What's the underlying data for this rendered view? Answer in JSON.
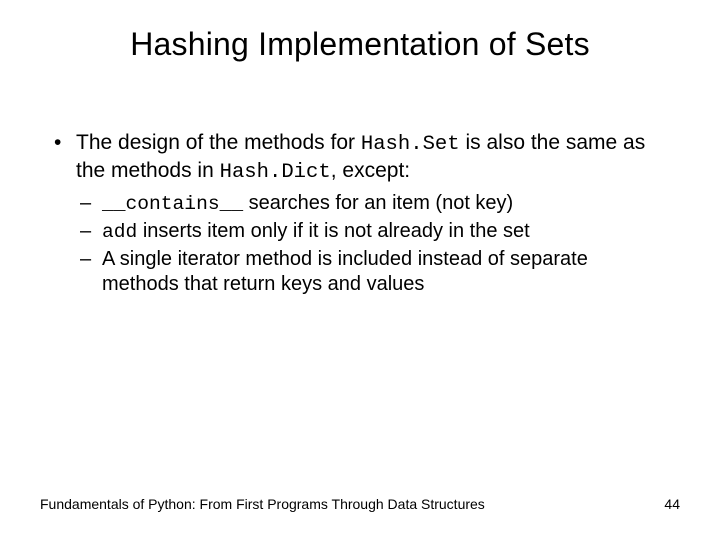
{
  "title": "Hashing Implementation of Sets",
  "bullet1": {
    "pre": "The design of the methods for ",
    "code": "Hash.Set",
    "mid": " is also the same as the methods in ",
    "code2": "Hash.Dict",
    "post": ", except:"
  },
  "sub1": {
    "code": "__contains__",
    "text": " searches for an item (not key)"
  },
  "sub2": {
    "code": "add",
    "text": " inserts item only if it is not already in the set"
  },
  "sub3": "A single iterator method is included instead of separate methods that return keys and values",
  "footer": {
    "source": "Fundamentals of Python: From First Programs Through Data Structures",
    "page": "44"
  }
}
